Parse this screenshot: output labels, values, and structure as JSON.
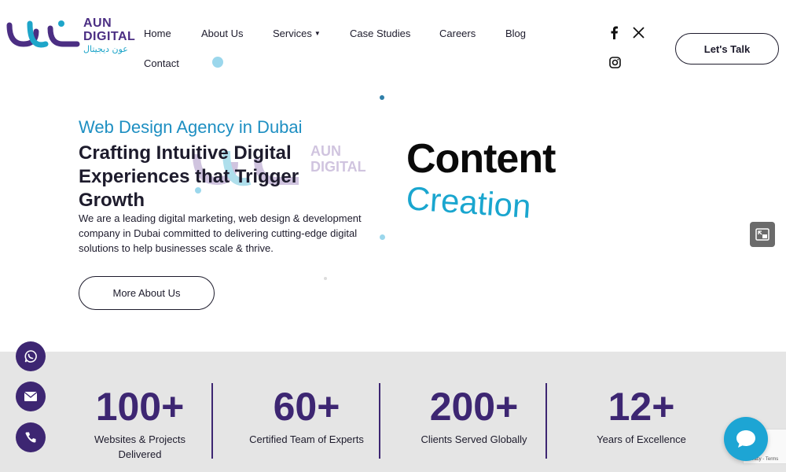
{
  "brand": {
    "name_line1": "AUN",
    "name_line2": "DIGITAL",
    "name_arabic": "عون ديجيتال",
    "colors": {
      "primary": "#3d2672",
      "accent": "#1e8fc2"
    }
  },
  "nav": {
    "items": [
      "Home",
      "About Us",
      "Services",
      "Case Studies",
      "Careers",
      "Blog",
      "Contact"
    ],
    "services_has_dropdown": true
  },
  "social": {
    "icons": [
      "facebook-icon",
      "x-icon",
      "instagram-icon"
    ]
  },
  "header": {
    "cta_label": "Let's Talk"
  },
  "hero": {
    "subtitle": "Web Design Agency in Dubai",
    "title": "Crafting Intuitive Digital Experiences that Trigger Growth",
    "description": "We are a leading digital marketing, web design & development company in Dubai committed to delivering cutting-edge digital solutions to help businesses scale & thrive.",
    "button_label": "More About Us",
    "visual_line1": "Content",
    "visual_line2": "Creation"
  },
  "stats": [
    {
      "value": "100+",
      "label": "Websites & Projects Delivered"
    },
    {
      "value": "60+",
      "label": "Certified Team of Experts"
    },
    {
      "value": "200+",
      "label": "Clients Served Globally"
    },
    {
      "value": "12+",
      "label": "Years of Excellence"
    }
  ],
  "floating_contacts": [
    "whatsapp-icon",
    "email-icon",
    "phone-icon"
  ],
  "recaptcha": {
    "text": "Privacy - Terms"
  }
}
